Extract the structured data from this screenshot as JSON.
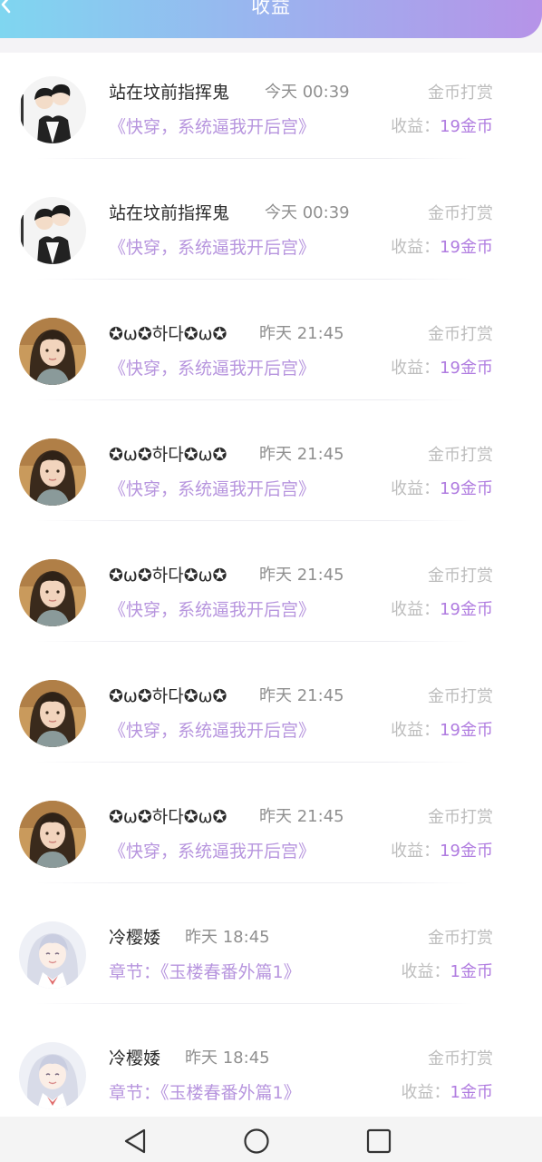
{
  "header": {
    "title": "收益",
    "back_icon": "chevron-left-icon"
  },
  "records": [
    {
      "user": "站在坟前指挥鬼",
      "time": "今天 00:39",
      "type": "金币打赏",
      "book": "《快穿，系统逼我开后宫》",
      "earn_label": "收益：",
      "earn_value": "19金币",
      "avatar": "couple-avatar"
    },
    {
      "user": "站在坟前指挥鬼",
      "time": "今天 00:39",
      "type": "金币打赏",
      "book": "《快穿，系统逼我开后宫》",
      "earn_label": "收益：",
      "earn_value": "19金币",
      "avatar": "couple-avatar"
    },
    {
      "user": "✪ω✪하다✪ω✪",
      "time": "昨天 21:45",
      "type": "金币打赏",
      "book": "《快穿，系统逼我开后宫》",
      "earn_label": "收益：",
      "earn_value": "19金币",
      "avatar": "girl-avatar"
    },
    {
      "user": "✪ω✪하다✪ω✪",
      "time": "昨天 21:45",
      "type": "金币打赏",
      "book": "《快穿，系统逼我开后宫》",
      "earn_label": "收益：",
      "earn_value": "19金币",
      "avatar": "girl-avatar"
    },
    {
      "user": "✪ω✪하다✪ω✪",
      "time": "昨天 21:45",
      "type": "金币打赏",
      "book": "《快穿，系统逼我开后宫》",
      "earn_label": "收益：",
      "earn_value": "19金币",
      "avatar": "girl-avatar"
    },
    {
      "user": "✪ω✪하다✪ω✪",
      "time": "昨天 21:45",
      "type": "金币打赏",
      "book": "《快穿，系统逼我开后宫》",
      "earn_label": "收益：",
      "earn_value": "19金币",
      "avatar": "girl-avatar"
    },
    {
      "user": "✪ω✪하다✪ω✪",
      "time": "昨天 21:45",
      "type": "金币打赏",
      "book": "《快穿，系统逼我开后宫》",
      "earn_label": "收益：",
      "earn_value": "19金币",
      "avatar": "girl-avatar"
    },
    {
      "user": "冷樱婑",
      "time": "昨天 18:45",
      "type": "金币打赏",
      "book": "章节：《玉楼春番外篇1》",
      "earn_label": "收益：",
      "earn_value": "1金币",
      "avatar": "anime-avatar"
    },
    {
      "user": "冷樱婑",
      "time": "昨天 18:45",
      "type": "金币打赏",
      "book": "章节：《玉楼春番外篇1》",
      "earn_label": "收益：",
      "earn_value": "1金币",
      "avatar": "anime-avatar"
    }
  ],
  "navbar": {
    "back_icon": "triangle-back-icon",
    "home_icon": "circle-home-icon",
    "recents_icon": "square-recents-icon"
  },
  "colors": {
    "accent": "#b795de",
    "header_start": "#7fd6f0",
    "header_end": "#b693e8"
  }
}
